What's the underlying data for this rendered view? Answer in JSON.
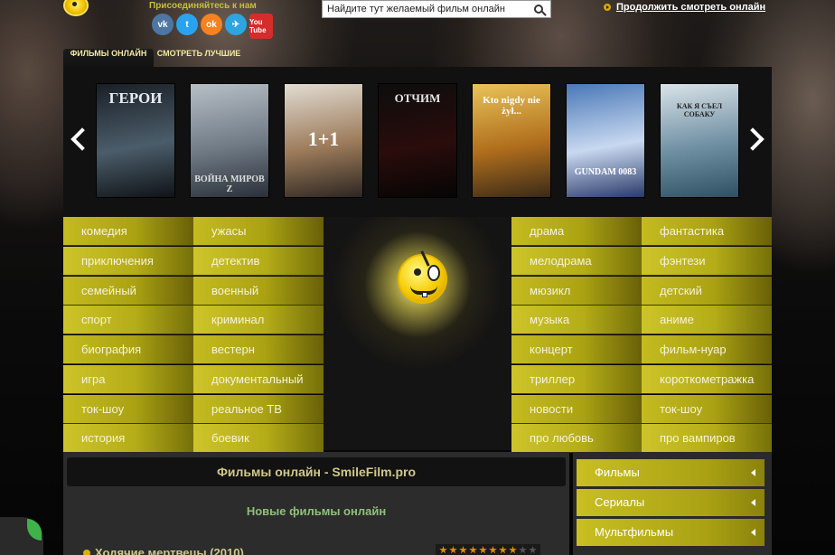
{
  "header": {
    "join_label": "Присоединяйтесь к нам",
    "socials": [
      {
        "name": "vk",
        "label": "vk",
        "color": "#4d76a1"
      },
      {
        "name": "twitter",
        "label": "t",
        "color": "#2aa3ef"
      },
      {
        "name": "odnoklassniki",
        "label": "ok",
        "color": "#f58220"
      },
      {
        "name": "telegram",
        "label": "✈",
        "color": "#2ca5e0"
      },
      {
        "name": "youtube",
        "label": "You Tube",
        "color": "#d62c2c"
      }
    ],
    "search": {
      "placeholder": "Найдите тут желаемый фильм онлайн"
    },
    "continue_label": "Продолжить смотреть онлайн"
  },
  "slider": {
    "tabs": [
      "ФИЛЬМЫ ОНЛАЙН",
      "СМОТРЕТЬ ЛУЧШИЕ"
    ],
    "posters": [
      {
        "title": "ГЕРОИ",
        "colors": [
          "#1a1f26",
          "#4b5d6a",
          "#101317"
        ]
      },
      {
        "title": "ВОЙНА МИРОВ Z",
        "colors": [
          "#b7bfc6",
          "#6f7a85",
          "#2a3038"
        ]
      },
      {
        "title": "1+1",
        "colors": [
          "#e2dcd2",
          "#9c7b5a",
          "#2d2622"
        ]
      },
      {
        "title": "ОТЧИМ",
        "colors": [
          "#0d0d0d",
          "#2a0c0c",
          "#050505"
        ]
      },
      {
        "title": "Kto nigdy nie żył...",
        "colors": [
          "#e9c35a",
          "#b06e1c",
          "#3a2a18"
        ]
      },
      {
        "title": "GUNDAM 0083",
        "colors": [
          "#4a78b8",
          "#c8d8f0",
          "#2a3a6a"
        ]
      },
      {
        "title": "КАК Я СЪЕЛ СОБАКУ",
        "colors": [
          "#d9e3e8",
          "#6f8fa3",
          "#2f4f63"
        ]
      }
    ]
  },
  "genres": {
    "col1": [
      "комедия",
      "приключения",
      "семейный",
      "спорт",
      "биография",
      "игра",
      "ток-шоу",
      "история"
    ],
    "col2": [
      "ужасы",
      "детектив",
      "военный",
      "криминал",
      "вестерн",
      "документальный",
      "реальное ТВ",
      "боевик"
    ],
    "col3": [
      "драма",
      "мелодрама",
      "мюзикл",
      "музыка",
      "концерт",
      "триллер",
      "новости",
      "про любовь"
    ],
    "col4": [
      "фантастика",
      "фэнтези",
      "детский",
      "аниме",
      "фильм-нуар",
      "короткометражка",
      "ток-шоу",
      "про вампиров"
    ]
  },
  "main": {
    "title": "Фильмы онлайн - SmileFilm.pro",
    "subtitle": "Новые фильмы онлайн",
    "first_movie": "Ходячие мертвецы (2010)",
    "rating": 8,
    "rating_max": 10
  },
  "sidebar": {
    "items": [
      "Фильмы",
      "Сериалы",
      "Мультфильмы"
    ]
  },
  "colors": {
    "accent": "#c4bb20",
    "title_text": "#cfc88a",
    "subtitle_text": "#8fc07a"
  }
}
